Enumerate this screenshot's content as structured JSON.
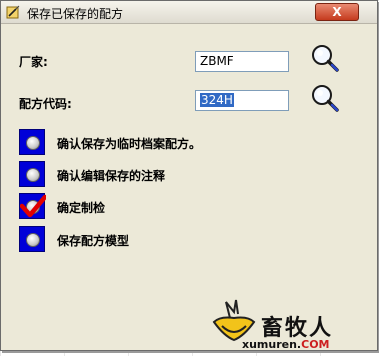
{
  "window": {
    "title": "保存已保存的配方",
    "close_label": "X"
  },
  "fields": {
    "manufacturer": {
      "label": "厂家:",
      "value": "ZBMF"
    },
    "formula_code": {
      "label": "配方代码:",
      "value": "324H"
    }
  },
  "options": [
    {
      "label": "确认保存为临时档案配方。",
      "checked": false
    },
    {
      "label": "确认编辑保存的注释",
      "checked": false
    },
    {
      "label": "确定制检",
      "checked": true
    },
    {
      "label": "保存配方模型",
      "checked": false
    }
  ],
  "icons": {
    "title": "app-icon",
    "search": "magnifier-icon"
  },
  "watermark": {
    "text": "畜牧人",
    "url_main": "xumuren.",
    "url_tld": "COM"
  },
  "colors": {
    "option_box": "#0000d8",
    "check": "#e00000",
    "selection": "#316ac5"
  }
}
